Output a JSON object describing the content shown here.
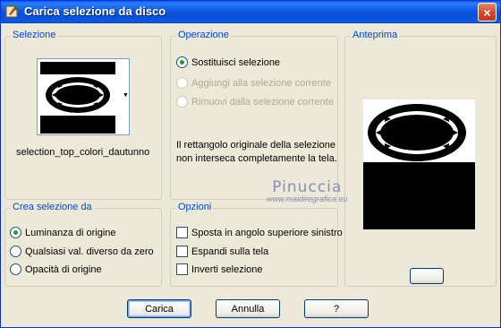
{
  "window": {
    "title": "Carica selezione da disco",
    "close_glyph": "×"
  },
  "selezione": {
    "label": "Selezione",
    "file_name": "selection_top_colori_dautunno"
  },
  "operazione": {
    "label": "Operazione",
    "options": [
      {
        "label": "Sostituisci selezione",
        "checked": true,
        "enabled": true
      },
      {
        "label": "Aggiungi alla selezione corrente",
        "checked": false,
        "enabled": false
      },
      {
        "label": "Rimuovi dalla selezione corrente",
        "checked": false,
        "enabled": false
      }
    ],
    "info_line1": "Il rettangolo originale della selezione",
    "info_line2": "non interseca completamente la tela."
  },
  "anteprima": {
    "label": "Anteprima"
  },
  "crea": {
    "label": "Crea selezione da",
    "options": [
      {
        "label": "Luminanza di origine",
        "checked": true
      },
      {
        "label": "Qualsiasi val. diverso da zero",
        "checked": false
      },
      {
        "label": "Opacità di origine",
        "checked": false
      }
    ]
  },
  "opzioni": {
    "label": "Opzioni",
    "options": [
      {
        "label": "Sposta in angolo superiore sinistro",
        "checked": false
      },
      {
        "label": "Espandi sulla tela",
        "checked": false
      },
      {
        "label": "Inverti selezione",
        "checked": false
      }
    ]
  },
  "buttons": {
    "load": "Carica",
    "cancel": "Annulla",
    "help": "?"
  },
  "watermark": {
    "name": "Pinuccia",
    "url": "www.maidiregrafica.eu"
  },
  "colors": {
    "title_bar": "#0A5CE6",
    "group_label": "#0046D5",
    "face": "#ECE9D8"
  },
  "icons": {
    "app": "psp-app-icon",
    "close": "close-icon",
    "dropdown": "chevron-down-icon"
  }
}
